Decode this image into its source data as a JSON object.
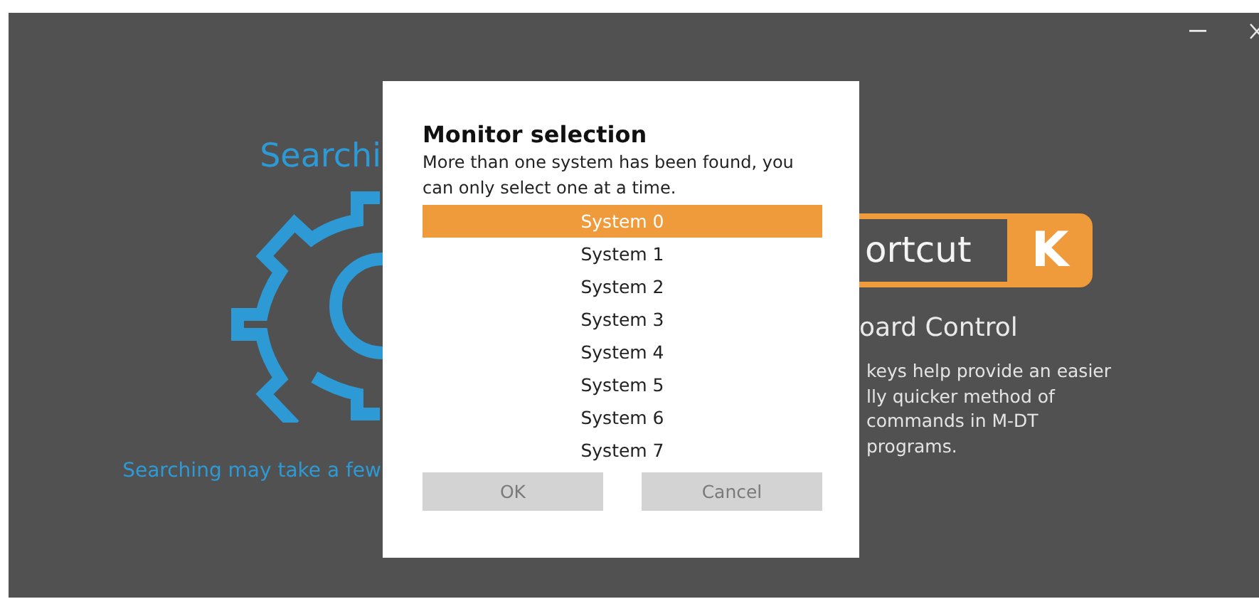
{
  "background": {
    "heading": "Searchi",
    "note": "Searching may take a few",
    "logo": {
      "word": "ortcut",
      "letter": "K"
    },
    "title": "oard Control",
    "description": [
      "keys help provide an easier",
      "lly quicker method of",
      "commands in M-DT",
      "programs."
    ]
  },
  "dialog": {
    "title": "Monitor selection",
    "message": "More than one system has been found, you can only select one at a time.",
    "systems": [
      {
        "label": "System 0",
        "selected": true
      },
      {
        "label": "System 1",
        "selected": false
      },
      {
        "label": "System 2",
        "selected": false
      },
      {
        "label": "System 3",
        "selected": false
      },
      {
        "label": "System 4",
        "selected": false
      },
      {
        "label": "System 5",
        "selected": false
      },
      {
        "label": "System 6",
        "selected": false
      },
      {
        "label": "System 7",
        "selected": false
      }
    ],
    "buttons": [
      {
        "label": "OK",
        "disabled": true
      },
      {
        "label": "Cancel",
        "disabled": true
      }
    ]
  }
}
